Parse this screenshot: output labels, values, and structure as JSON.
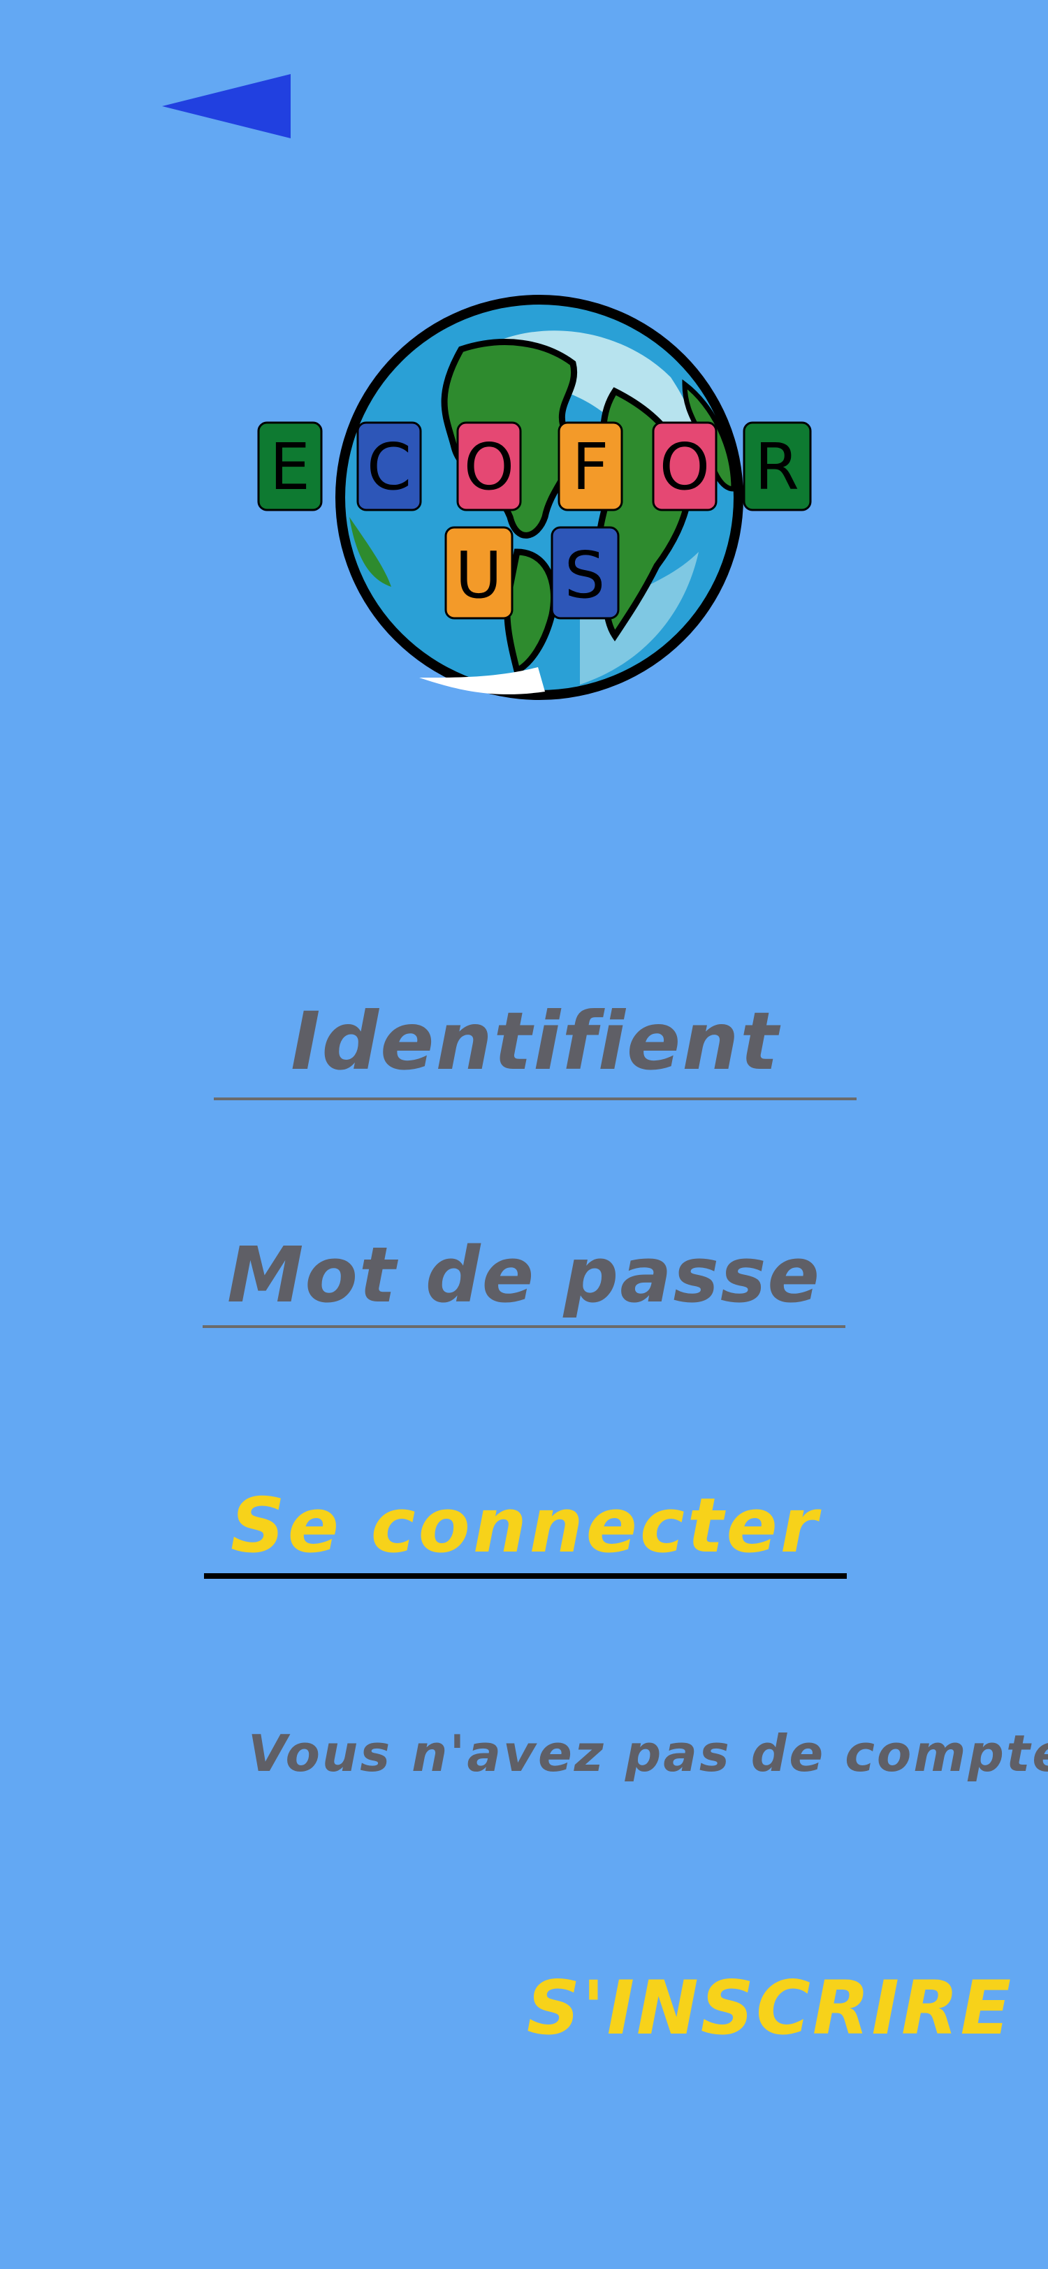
{
  "colors": {
    "background": "#63a8f3",
    "accent_yellow": "#f7d21a",
    "text_gray": "#5f5f66",
    "back_arrow": "#2140e0"
  },
  "header": {
    "back_icon": "back-arrow-icon"
  },
  "logo": {
    "top_row": [
      "E",
      "C",
      "O",
      "F",
      "O",
      "R"
    ],
    "bottom_row": [
      "U",
      "S"
    ]
  },
  "form": {
    "username_placeholder": "Identifient",
    "password_placeholder": "Mot de passe",
    "login_label": "Se connecter"
  },
  "footer": {
    "no_account_text": "Vous n'avez pas de compte",
    "register_label": "S'INSCRIRE"
  }
}
